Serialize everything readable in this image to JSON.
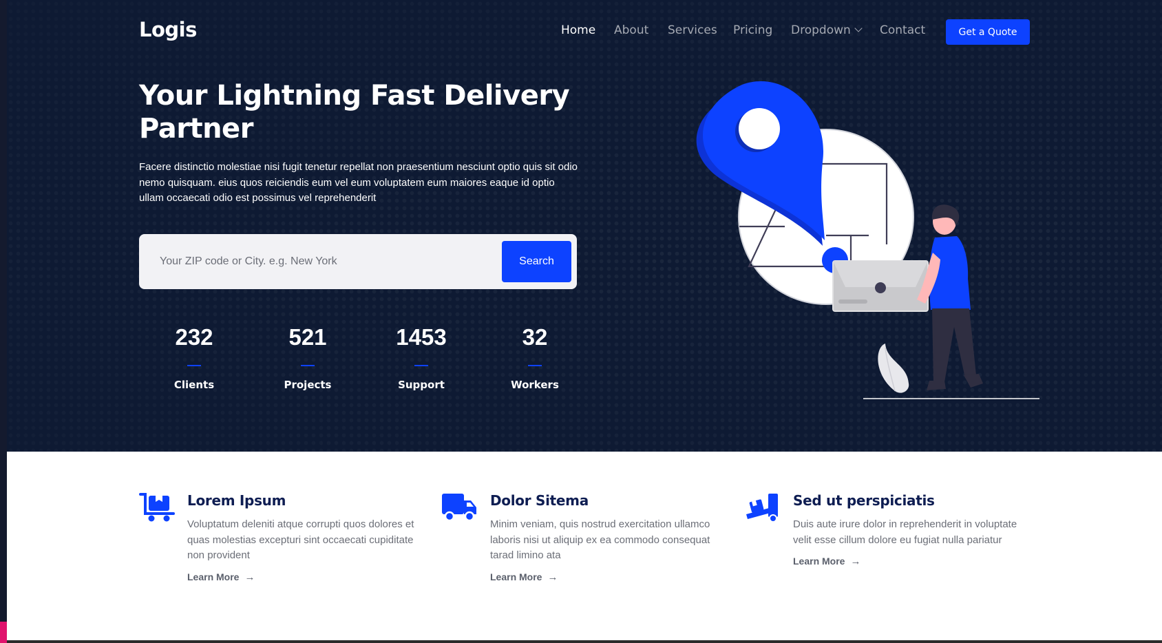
{
  "header": {
    "logo": "Logis",
    "nav": [
      {
        "label": "Home",
        "active": true
      },
      {
        "label": "About",
        "active": false
      },
      {
        "label": "Services",
        "active": false
      },
      {
        "label": "Pricing",
        "active": false
      },
      {
        "label": "Dropdown",
        "active": false,
        "has_caret": true
      },
      {
        "label": "Contact",
        "active": false
      }
    ],
    "cta_label": "Get a Quote"
  },
  "hero": {
    "title": "Your Lightning Fast Delivery Partner",
    "description": "Facere distinctio molestiae nisi fugit tenetur repellat non praesentium nesciunt optio quis sit odio nemo quisquam. eius quos reiciendis eum vel eum voluptatem eum maiores eaque id optio ullam occaecati odio est possimus vel reprehenderit",
    "search": {
      "placeholder": "Your ZIP code or City. e.g. New York",
      "value": "",
      "button_label": "Search"
    },
    "stats": [
      {
        "value": "232",
        "label": "Clients"
      },
      {
        "value": "521",
        "label": "Projects"
      },
      {
        "value": "1453",
        "label": "Support"
      },
      {
        "value": "32",
        "label": "Workers"
      }
    ],
    "illustration_icon": "map-pin-delivery-person-illustration"
  },
  "features": [
    {
      "icon": "cart-flatbed-boxes-icon",
      "title": "Lorem Ipsum",
      "text": "Voluptatum deleniti atque corrupti quos dolores et quas molestias excepturi sint occaecati cupiditate non provident",
      "link_label": "Learn More"
    },
    {
      "icon": "truck-icon",
      "title": "Dolor Sitema",
      "text": "Minim veniam, quis nostrud exercitation ullamco laboris nisi ut aliquip ex ea commodo consequat tarad limino ata",
      "link_label": "Learn More"
    },
    {
      "icon": "truck-ramp-box-icon",
      "title": "Sed ut perspiciatis",
      "text": "Duis aute irure dolor in reprehenderit in voluptate velit esse cillum dolore eu fugiat nulla pariatur",
      "link_label": "Learn More"
    }
  ],
  "colors": {
    "hero_bg": "#0e1a33",
    "accent": "#0d42ff",
    "feature_title": "#0e1d52",
    "body_text": "#6b6e77"
  }
}
